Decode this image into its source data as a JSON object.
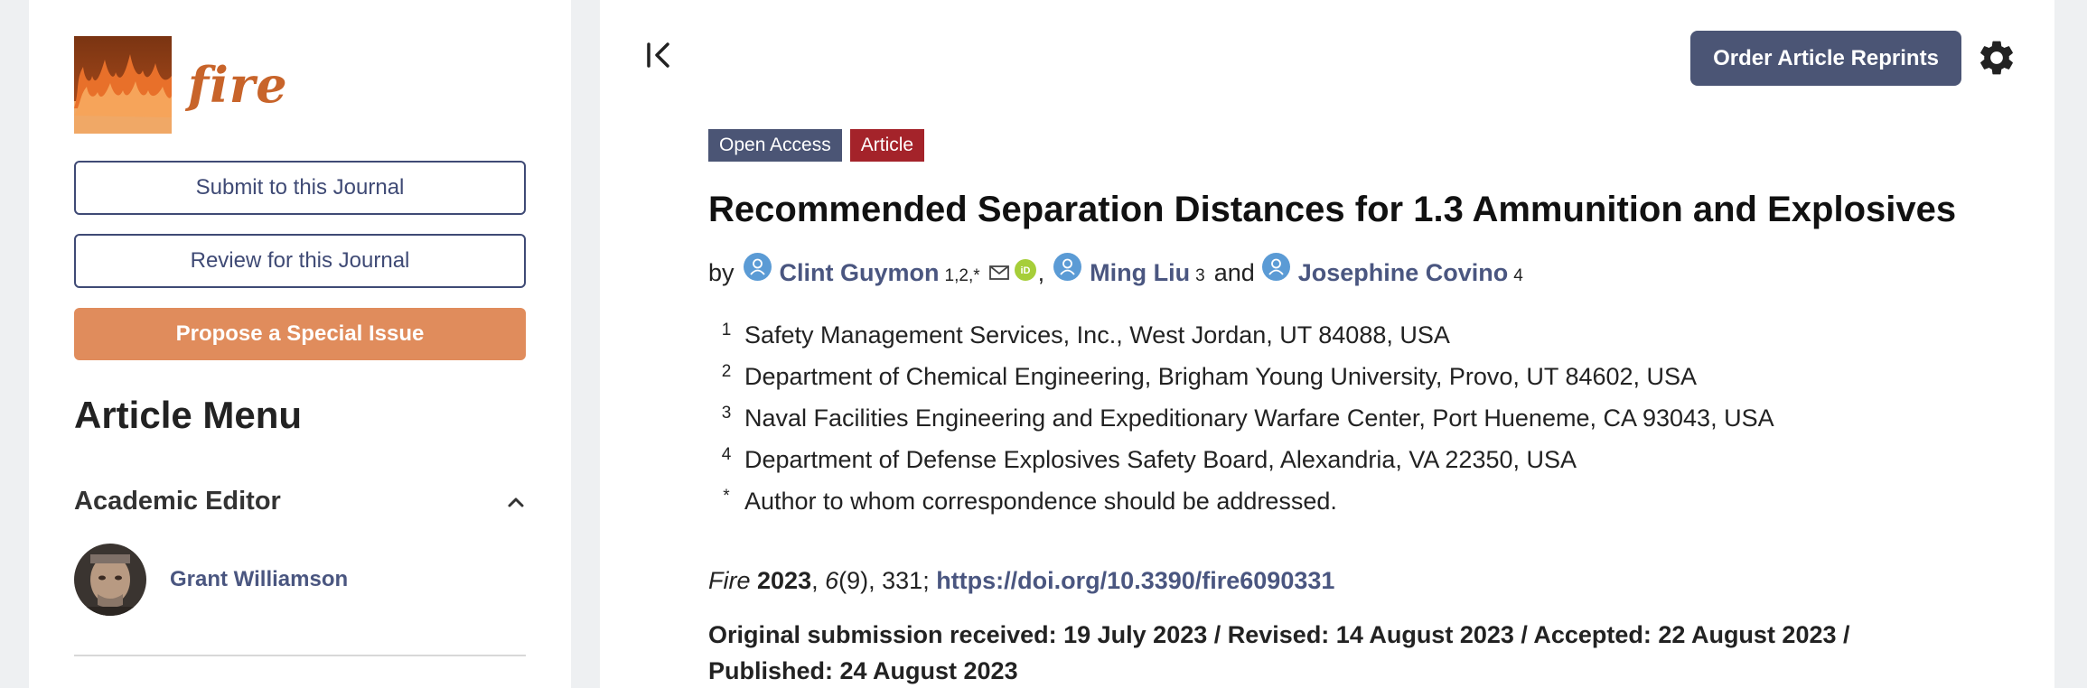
{
  "sidebar": {
    "logo_text": "fire",
    "submit_label": "Submit to this Journal",
    "review_label": "Review for this Journal",
    "propose_label": "Propose a Special Issue",
    "menu_title": "Article Menu",
    "academic_editor_label": "Academic Editor",
    "editor_name": "Grant Williamson"
  },
  "header": {
    "reprints_label": "Order Article Reprints"
  },
  "article": {
    "badges": {
      "open_access": "Open Access",
      "type": "Article"
    },
    "title": "Recommended Separation Distances for 1.3 Ammunition and Explosives",
    "by_label": "by",
    "authors": [
      {
        "name": "Clint Guymon",
        "sup": "1,2,*"
      },
      {
        "name": "Ming Liu",
        "sup": "3"
      },
      {
        "name": "Josephine Covino",
        "sup": "4"
      }
    ],
    "comma": ",",
    "and_label": "and",
    "affiliations": [
      {
        "num": "1",
        "text": "Safety Management Services, Inc., West Jordan, UT 84088, USA"
      },
      {
        "num": "2",
        "text": "Department of Chemical Engineering, Brigham Young University, Provo, UT 84602, USA"
      },
      {
        "num": "3",
        "text": "Naval Facilities Engineering and Expeditionary Warfare Center, Port Hueneme, CA 93043, USA"
      },
      {
        "num": "4",
        "text": "Department of Defense Explosives Safety Board, Alexandria, VA 22350, USA"
      },
      {
        "num": "*",
        "text": "Author to whom correspondence should be addressed."
      }
    ],
    "citation": {
      "journal": "Fire",
      "year": "2023",
      "volume": "6",
      "rest": "(9), 331; ",
      "doi": "https://doi.org/10.3390/fire6090331"
    },
    "dates": "Original submission received: 19 July 2023 / Revised: 14 August 2023 / Accepted: 22 August 2023 / Published: 24 August 2023"
  },
  "colors": {
    "accent": "#4b5575",
    "article_badge": "#a4232a",
    "propose_button": "#e08c5c",
    "link": "#4a5680"
  },
  "icons": [
    "fire-logo-icon",
    "chevron-up-icon",
    "collapse-sidebar-icon",
    "gear-icon",
    "person-icon",
    "mail-icon",
    "orcid-icon"
  ]
}
